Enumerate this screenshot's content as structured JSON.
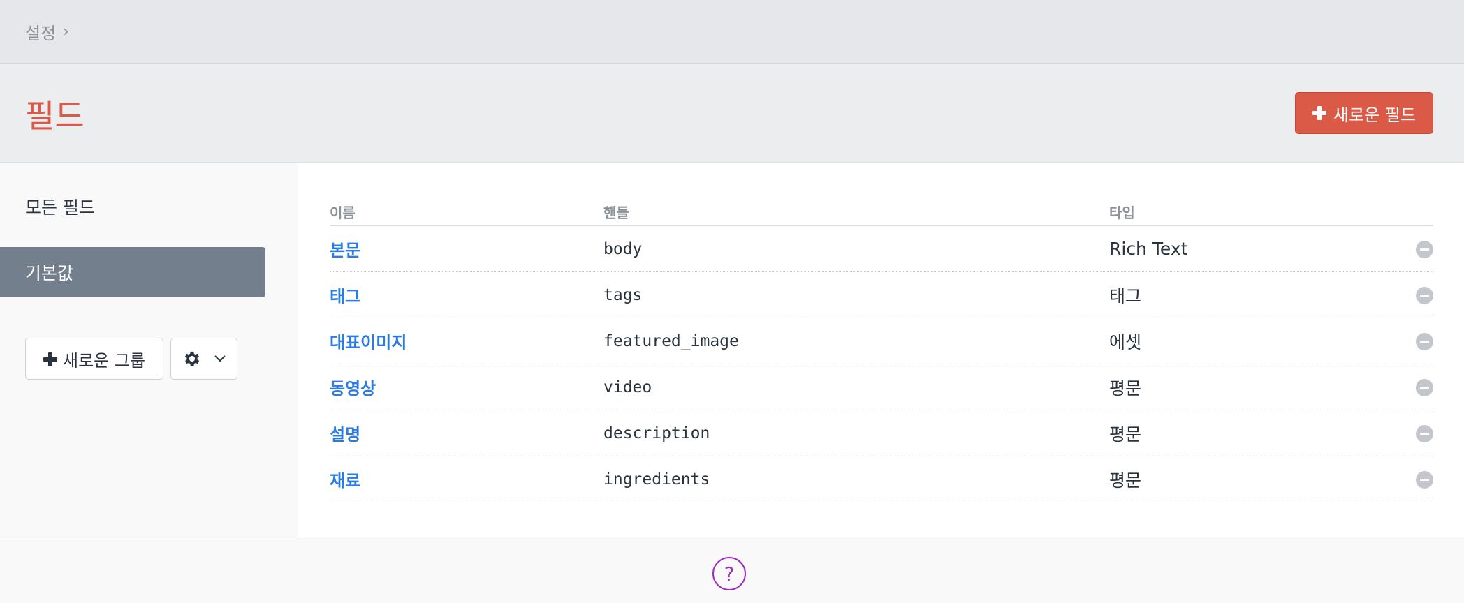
{
  "breadcrumb": {
    "item": "설정",
    "separator": "›"
  },
  "header": {
    "title": "필드",
    "new_field_label": "새로운 필드"
  },
  "sidebar": {
    "items": [
      {
        "label": "모든 필드",
        "active": false
      },
      {
        "label": "기본값",
        "active": true
      }
    ],
    "new_group_label": "새로운 그룹"
  },
  "table": {
    "columns": {
      "name": "이름",
      "handle": "핸들",
      "type": "타입"
    },
    "rows": [
      {
        "name": "본문",
        "handle": "body",
        "type": "Rich Text"
      },
      {
        "name": "태그",
        "handle": "tags",
        "type": "태그"
      },
      {
        "name": "대표이미지",
        "handle": "featured_image",
        "type": "에셋"
      },
      {
        "name": "동영상",
        "handle": "video",
        "type": "평문"
      },
      {
        "name": "설명",
        "handle": "description",
        "type": "평문"
      },
      {
        "name": "재료",
        "handle": "ingredients",
        "type": "평문"
      }
    ]
  },
  "footer": {
    "help_symbol": "?"
  },
  "colors": {
    "accent": "#da5a47",
    "link": "#2c7be5",
    "sidebar_active": "#737f8c",
    "help": "#a02bbf"
  },
  "icons": [
    "chevron-right-icon",
    "plus-icon",
    "gear-icon",
    "chevron-down-icon",
    "remove-icon",
    "help-icon"
  ]
}
